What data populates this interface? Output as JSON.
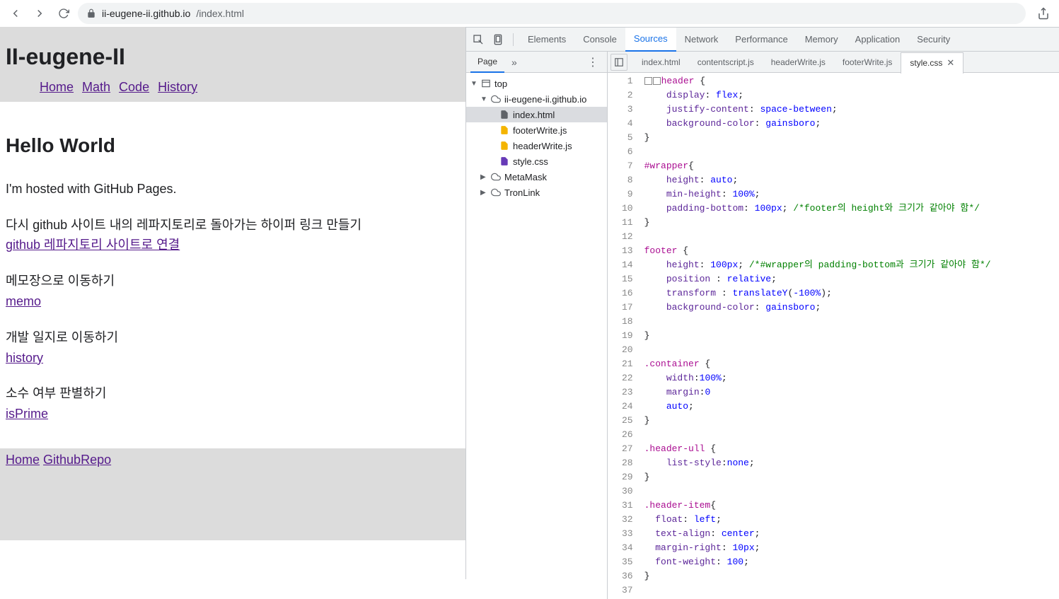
{
  "browser": {
    "url_host": "ii-eugene-ii.github.io",
    "url_path": "/index.html"
  },
  "page": {
    "header_title": "II-eugene-II",
    "nav": [
      "Home",
      "Math",
      "Code",
      "History"
    ],
    "heading": "Hello World",
    "intro": "I'm hosted with GitHub Pages.",
    "sections": [
      {
        "text": "다시 github 사이트 내의 레파지토리로 돌아가는 하이퍼 링크 만들기",
        "link": "github 레파지토리 사이트로 연결"
      },
      {
        "text": "메모장으로 이동하기",
        "link": "memo"
      },
      {
        "text": "개발 일지로 이동하기",
        "link": "history"
      },
      {
        "text": "소수 여부 판별하기",
        "link": "isPrime"
      }
    ],
    "footer": [
      "Home",
      "GithubRepo"
    ]
  },
  "devtools": {
    "main_tabs": [
      "Elements",
      "Console",
      "Sources",
      "Network",
      "Performance",
      "Memory",
      "Application",
      "Security"
    ],
    "active_main_tab": "Sources",
    "side_tab": "Page",
    "tree": {
      "top": "top",
      "domain": "ii-eugene-ii.github.io",
      "files": [
        "index.html",
        "footerWrite.js",
        "headerWrite.js",
        "style.css"
      ],
      "extra": [
        "MetaMask",
        "TronLink"
      ]
    },
    "file_tabs": [
      "index.html",
      "contentscript.js",
      "headerWrite.js",
      "footerWrite.js",
      "style.css"
    ],
    "active_file": "style.css",
    "code_lines": [
      {
        "n": 1,
        "html": "<span class='checkbox-box'></span><span class='checkbox-box'></span><span class='c-pink'>header</span> {"
      },
      {
        "n": 2,
        "html": "    <span class='c-purple'>display</span>: <span class='c-blue'>flex</span>;"
      },
      {
        "n": 3,
        "html": "    <span class='c-purple'>justify-content</span>: <span class='c-blue'>space-between</span>;"
      },
      {
        "n": 4,
        "html": "    <span class='c-purple'>background-color</span>: <span class='c-blue'>gainsboro</span>;"
      },
      {
        "n": 5,
        "html": "}"
      },
      {
        "n": 6,
        "html": ""
      },
      {
        "n": 7,
        "html": "<span class='c-pink'>#wrapper</span>{"
      },
      {
        "n": 8,
        "html": "    <span class='c-purple'>height</span>: <span class='c-blue'>auto</span>;"
      },
      {
        "n": 9,
        "html": "    <span class='c-purple'>min-height</span>: <span class='c-blue'>100%</span>;"
      },
      {
        "n": 10,
        "html": "    <span class='c-purple'>padding-bottom</span>: <span class='c-blue'>100px</span>; <span class='c-green'>/*footer의 height와 크기가 같아야 함*/</span>"
      },
      {
        "n": 11,
        "html": "}"
      },
      {
        "n": 12,
        "html": ""
      },
      {
        "n": 13,
        "html": "<span class='c-pink'>footer</span> {"
      },
      {
        "n": 14,
        "html": "    <span class='c-purple'>height</span>: <span class='c-blue'>100px</span>; <span class='c-green'>/*#wrapper의 padding-bottom과 크기가 같아야 함*/</span>"
      },
      {
        "n": 15,
        "html": "    <span class='c-purple'>position</span> : <span class='c-blue'>relative</span>;"
      },
      {
        "n": 16,
        "html": "    <span class='c-purple'>transform</span> : <span class='c-blue'>translateY</span>(<span class='c-blue'>-100%</span>);"
      },
      {
        "n": 17,
        "html": "    <span class='c-purple'>background-color</span>: <span class='c-blue'>gainsboro</span>;"
      },
      {
        "n": 18,
        "html": ""
      },
      {
        "n": 19,
        "html": "}"
      },
      {
        "n": 20,
        "html": ""
      },
      {
        "n": 21,
        "html": "<span class='c-pink'>.container</span> {"
      },
      {
        "n": 22,
        "html": "    <span class='c-purple'>width</span>:<span class='c-blue'>100%</span>;"
      },
      {
        "n": 23,
        "html": "    <span class='c-purple'>margin</span>:<span class='c-blue'>0</span>"
      },
      {
        "n": 24,
        "html": "    <span class='c-blue'>auto</span>;"
      },
      {
        "n": 25,
        "html": "}"
      },
      {
        "n": 26,
        "html": ""
      },
      {
        "n": 27,
        "html": "<span class='c-pink'>.header-ull</span> {"
      },
      {
        "n": 28,
        "html": "    <span class='c-purple'>list-style</span>:<span class='c-blue'>none</span>;"
      },
      {
        "n": 29,
        "html": "}"
      },
      {
        "n": 30,
        "html": ""
      },
      {
        "n": 31,
        "html": "<span class='c-pink'>.header-item</span>{"
      },
      {
        "n": 32,
        "html": "  <span class='c-purple'>float</span>: <span class='c-blue'>left</span>;"
      },
      {
        "n": 33,
        "html": "  <span class='c-purple'>text-align</span>: <span class='c-blue'>center</span>;"
      },
      {
        "n": 34,
        "html": "  <span class='c-purple'>margin-right</span>: <span class='c-blue'>10px</span>;"
      },
      {
        "n": 35,
        "html": "  <span class='c-purple'>font-weight</span>: <span class='c-blue'>100</span>;"
      },
      {
        "n": 36,
        "html": "}"
      },
      {
        "n": 37,
        "html": ""
      }
    ]
  }
}
